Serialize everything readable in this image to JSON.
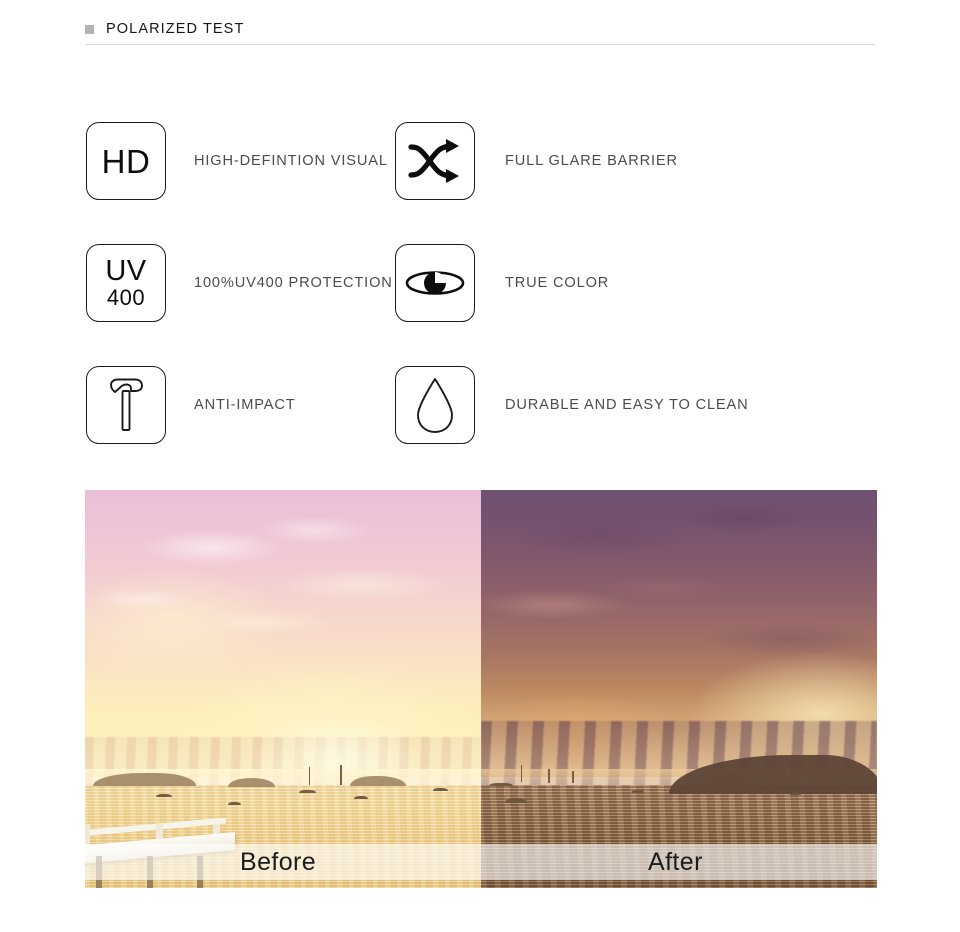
{
  "header": {
    "bullet_icon": "square-bullet-icon",
    "title": "POLARIZED TEST",
    "rule_color": "#d7d7d7",
    "bullet_color": "#b4b4b4"
  },
  "features": [
    {
      "icon": "hd-badge-icon",
      "icon_text": "HD",
      "label": "HIGH-DEFINTION VISUAL"
    },
    {
      "icon": "shuffle-arrows-icon",
      "icon_text": "",
      "label": "FULL GLARE BARRIER"
    },
    {
      "icon": "uv400-badge-icon",
      "icon_text_top": "UV",
      "icon_text_bottom": "400",
      "label": "100%UV400 PROTECTION"
    },
    {
      "icon": "eye-icon",
      "icon_text": "",
      "label": "TRUE COLOR"
    },
    {
      "icon": "hammer-icon",
      "icon_text": "",
      "label": "ANTI-IMPACT"
    },
    {
      "icon": "water-drop-icon",
      "icon_text": "",
      "label": "DURABLE AND EASY TO CLEAN"
    }
  ],
  "comparison": {
    "before_label": "Before",
    "after_label": "After",
    "before_description": "Sunset seascape washed out with pale pink and yellow haze, islands and boats on the horizon, white pier at lower left",
    "after_description": "Same sunset seascape with saturated purple clouds and deep golden water, dark headland at right",
    "before_colors": {
      "sky_top": "#e9c0d8",
      "sky_bottom": "#fdf3c6",
      "sea": "#f3d792"
    },
    "after_colors": {
      "sky_top": "#6f5070",
      "sky_bottom": "#eecda2",
      "sea": "#9c7653"
    },
    "band_color": "rgba(255,255,255,0.62)"
  }
}
